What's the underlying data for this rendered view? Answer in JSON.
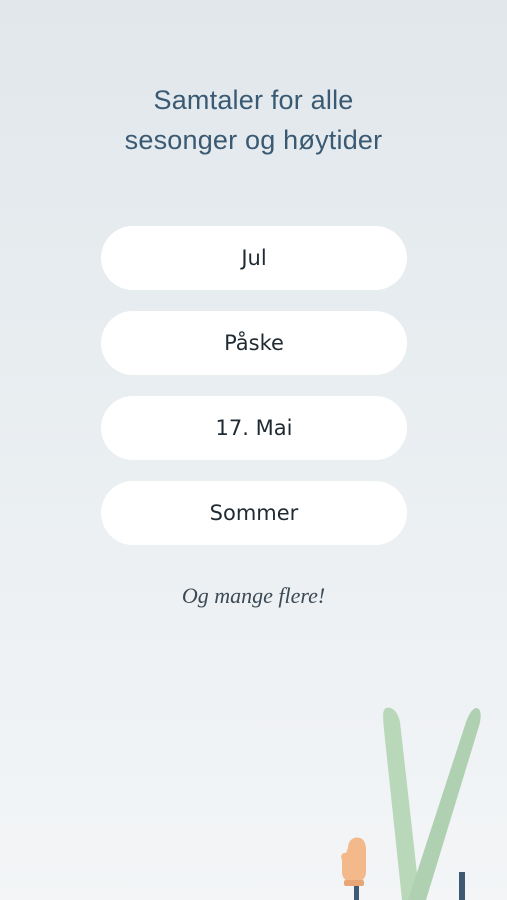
{
  "header": {
    "title_line1": "Samtaler for alle",
    "title_line2": "sesonger og høytider"
  },
  "options": [
    {
      "label": "Jul"
    },
    {
      "label": "Påske"
    },
    {
      "label": "17. Mai"
    },
    {
      "label": "Sommer"
    }
  ],
  "footer_text": "Og mange flere!",
  "illustration": {
    "name": "skis-and-mitten",
    "colors": {
      "ski": "#b9d8b9",
      "mitten": "#f3b98a",
      "pole": "#3e5a72"
    }
  }
}
